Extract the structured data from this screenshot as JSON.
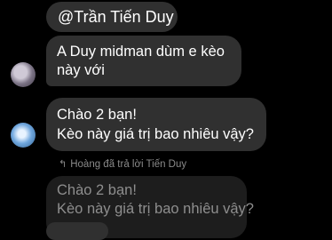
{
  "messages": [
    {
      "text": "@Trần Tiến Duy"
    },
    {
      "lines": [
        "A Duy midman dùm e kèo",
        "này với"
      ]
    },
    {
      "lines": [
        "Chào 2 bạn!",
        "Kèo này giá trị bao nhiêu vậy?"
      ]
    }
  ],
  "reply": {
    "header": "Hoàng đã trả lời Tiến Duy",
    "icon": "reply-arrow-icon",
    "quoted_lines": [
      "Chào 2 bạn!",
      "Kèo này giá trị bao nhiêu vậy?"
    ]
  },
  "colors": {
    "background": "#000000",
    "bubble": "#303030",
    "quoted_bubble": "#1d1d1d",
    "meta_text": "#8a8a8a"
  }
}
